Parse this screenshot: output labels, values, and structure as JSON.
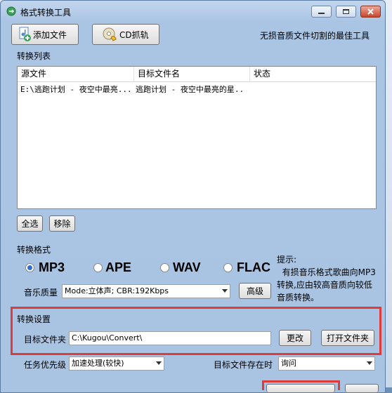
{
  "window": {
    "title": "格式转换工具"
  },
  "toolbar": {
    "add_file": "添加文件",
    "cd_rip": "CD抓轨",
    "slogan": "无损音质文件切割的最佳工具"
  },
  "convert_list": {
    "section_label": "转换列表",
    "columns": [
      "源文件",
      "目标文件名",
      "状态"
    ],
    "rows": [
      {
        "source": "E:\\逃跑计划 - 夜空中最亮...",
        "target": "逃跑计划 - 夜空中最亮的星..",
        "status": ""
      }
    ],
    "select_all": "全选",
    "remove": "移除"
  },
  "format": {
    "section_label": "转换格式",
    "options": [
      {
        "label": "MP3",
        "selected": true
      },
      {
        "label": "APE",
        "selected": false
      },
      {
        "label": "WAV",
        "selected": false
      },
      {
        "label": "FLAC",
        "selected": false
      }
    ],
    "quality_label": "音乐质量",
    "quality_value": "Mode:立体声; CBR:192Kbps",
    "advanced": "高级",
    "hint": "提示:\n  有损音乐格式歌曲向MP3转换,应由较高音质向较低音质转换。"
  },
  "settings": {
    "section_label": "转换设置",
    "target_folder_label": "目标文件夹",
    "target_folder_value": "C:\\Kugou\\Convert\\",
    "change": "更改",
    "open_folder": "打开文件夹",
    "priority_label": "任务优先级",
    "priority_value": "加速处理(较快)",
    "exists_label": "目标文件存在时",
    "exists_value": "询问"
  },
  "colors": {
    "highlight": "#e03a3a",
    "accent": "#2a6fd6"
  }
}
